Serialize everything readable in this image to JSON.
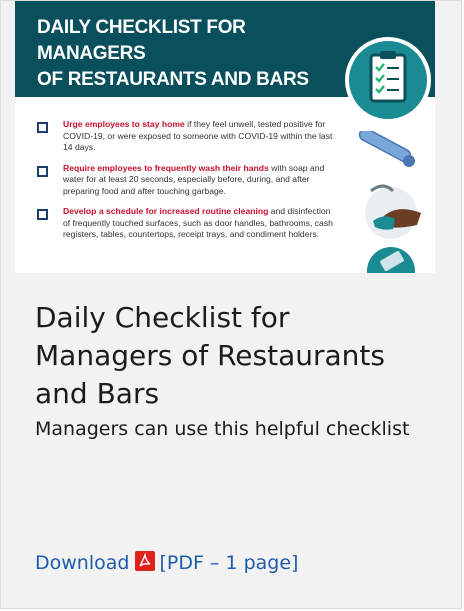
{
  "thumbnail": {
    "banner_title_line1": "DAILY CHECKLIST FOR MANAGERS",
    "banner_title_line2": "OF RESTAURANTS AND BARS",
    "items": [
      {
        "lead": "Urge employees to stay home",
        "text": " if they feel unwell, tested positive for COVID-19, or were exposed to someone with COVID-19 within the last 14 days."
      },
      {
        "lead": "Require employees to frequently wash their hands",
        "text": " with soap and water for at least 20 seconds, especially before, during, and after preparing food and after touching garbage."
      },
      {
        "lead": "Develop a schedule for increased routine cleaning",
        "text": " and disinfection of frequently touched surfaces, such as door handles, bathrooms, cash registers, tables, countertops, receipt trays, and condiment holders."
      }
    ],
    "colors": {
      "banner": "#0a4f5c",
      "accent_red": "#c8102e",
      "link_blue": "#1e5cab"
    }
  },
  "card": {
    "title": "Daily Checklist for Managers of Restaurants and Bars",
    "description": "Managers can use this helpful checklist",
    "download_label": "Download",
    "file_info": "[PDF – 1 page]",
    "file_icon": "pdf-icon"
  }
}
